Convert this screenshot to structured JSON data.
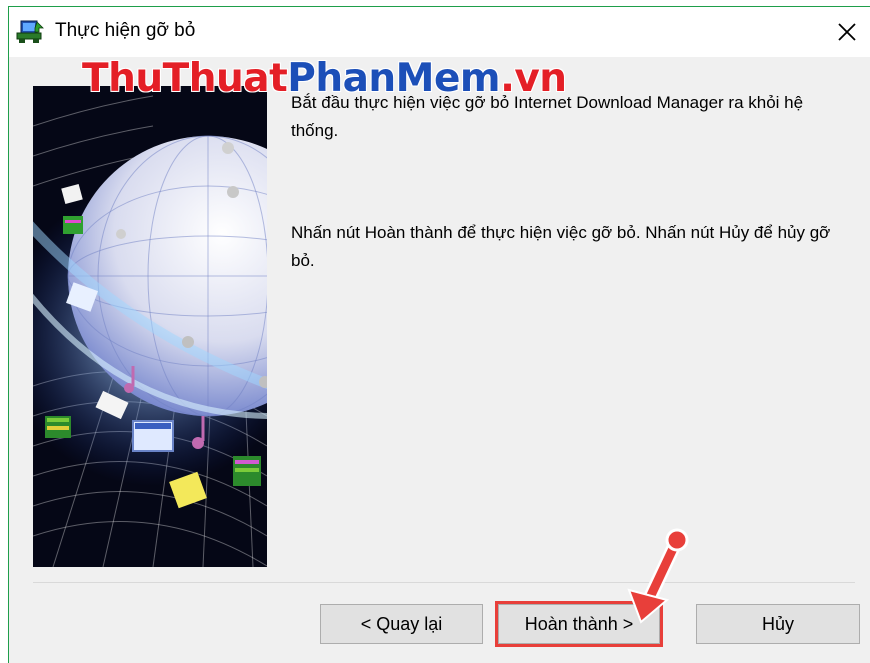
{
  "window": {
    "title": "Thực hiện gỡ bỏ",
    "close_symbol": "✕"
  },
  "watermark": {
    "part1": "ThuThuat",
    "part2": "PhanMem",
    "part3": ".vn"
  },
  "content": {
    "message1": "Bắt đầu thực hiện việc gỡ bỏ Internet Download Manager ra khỏi hệ thống.",
    "message2": "Nhấn nút Hoàn thành để thực hiện việc gỡ bỏ. Nhấn nút Hủy để hủy gỡ bỏ."
  },
  "buttons": {
    "back": "< Quay lại",
    "finish": "Hoàn thành >",
    "cancel": "Hủy"
  },
  "colors": {
    "accent_border": "#1e9e4a",
    "highlight": "#e83f3a",
    "watermark_red": "#e41f26",
    "watermark_blue": "#1c4fb8"
  },
  "icons": {
    "app": "installer-computer-icon",
    "close": "close-icon",
    "annotation": "red-arrow-icon"
  }
}
